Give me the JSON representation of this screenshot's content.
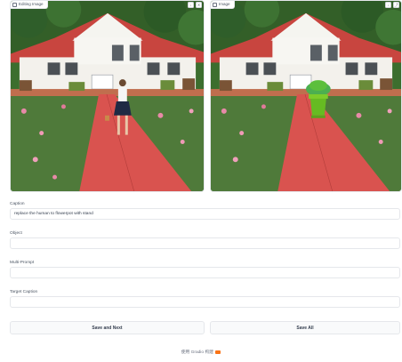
{
  "left_image": {
    "label": "Editing Image"
  },
  "right_image": {
    "label": "Image"
  },
  "form": {
    "caption_label": "Caption",
    "caption_value": "replace the human to flowerpot with stand",
    "object_label": "Object",
    "object_value": "",
    "multi_prompt_label": "Multi-Prompt",
    "multi_prompt_value": "",
    "target_caption_label": "Target Caption",
    "target_caption_value": ""
  },
  "buttons": {
    "save_next": "Save and Next",
    "save_all": "Save All"
  },
  "footer": {
    "text": "使用 Gradio 构建"
  },
  "colors": {
    "roof": "#c8453f",
    "walkway": "#d9534f",
    "lily_pads": "#4f7a3a",
    "trees": "#2f5e2a",
    "pot": "#66bb22"
  }
}
